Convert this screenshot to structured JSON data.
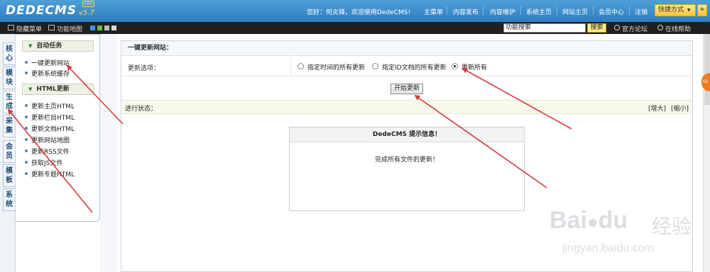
{
  "app": {
    "logo": "DEDECMS",
    "version": "v5.7",
    "badge": "GBK"
  },
  "topbar": {
    "greeting": "您好：何炎锋，欢迎使用DedeCMS!",
    "nav": [
      "主菜单",
      "内容发布",
      "内容维护",
      "系统主页",
      "网站主页",
      "会员中心",
      "注销"
    ],
    "quick": "快捷方式",
    "quick_arrow": "▼",
    "plus": "+"
  },
  "toolbar": {
    "hide_menu": "隐藏菜单",
    "site_map": "功能地图",
    "search_value": "功能搜索",
    "search_btn": "搜索",
    "forum": "官方论坛",
    "help": "在线帮助",
    "swatch_colors": [
      "#3a8ee6",
      "#6fbf3a",
      "#b9b9b9",
      "#d8d8d8"
    ]
  },
  "rail": {
    "tabs": [
      "核心",
      "模块",
      "生成",
      "采集",
      "会员",
      "模板",
      "系统"
    ],
    "active_index": 2
  },
  "sidebar": {
    "group1": {
      "title": "自动任务",
      "items": [
        "一键更新网站",
        "更新系统缓存"
      ]
    },
    "group2": {
      "title": "HTML更新",
      "items": [
        "更新主页HTML",
        "更新栏目HTML",
        "更新文档HTML",
        "更新网站地图",
        "更新RSS文件",
        "获取JS文件",
        "更新专题HTML"
      ]
    }
  },
  "main": {
    "title": "一键更新网站：",
    "option_label": "更新选项：",
    "options": [
      "指定时间的所有更新",
      "指定ID文档的所有更新",
      "更新所有"
    ],
    "selected_option": 2,
    "start_button": "开始更新",
    "progress_label": "进行状态：",
    "enlarge": "[增大]",
    "shrink": "[缩小]"
  },
  "message": {
    "title": "DedeCMS 提示信息！",
    "body": "完成所有文件的更新！"
  },
  "side_badge": "65",
  "watermark": {
    "brand": "Bai",
    "brand2": "du",
    "cn": "经验",
    "url": "jingyan.baidu.com"
  },
  "annotation_color": "#d33b3b"
}
